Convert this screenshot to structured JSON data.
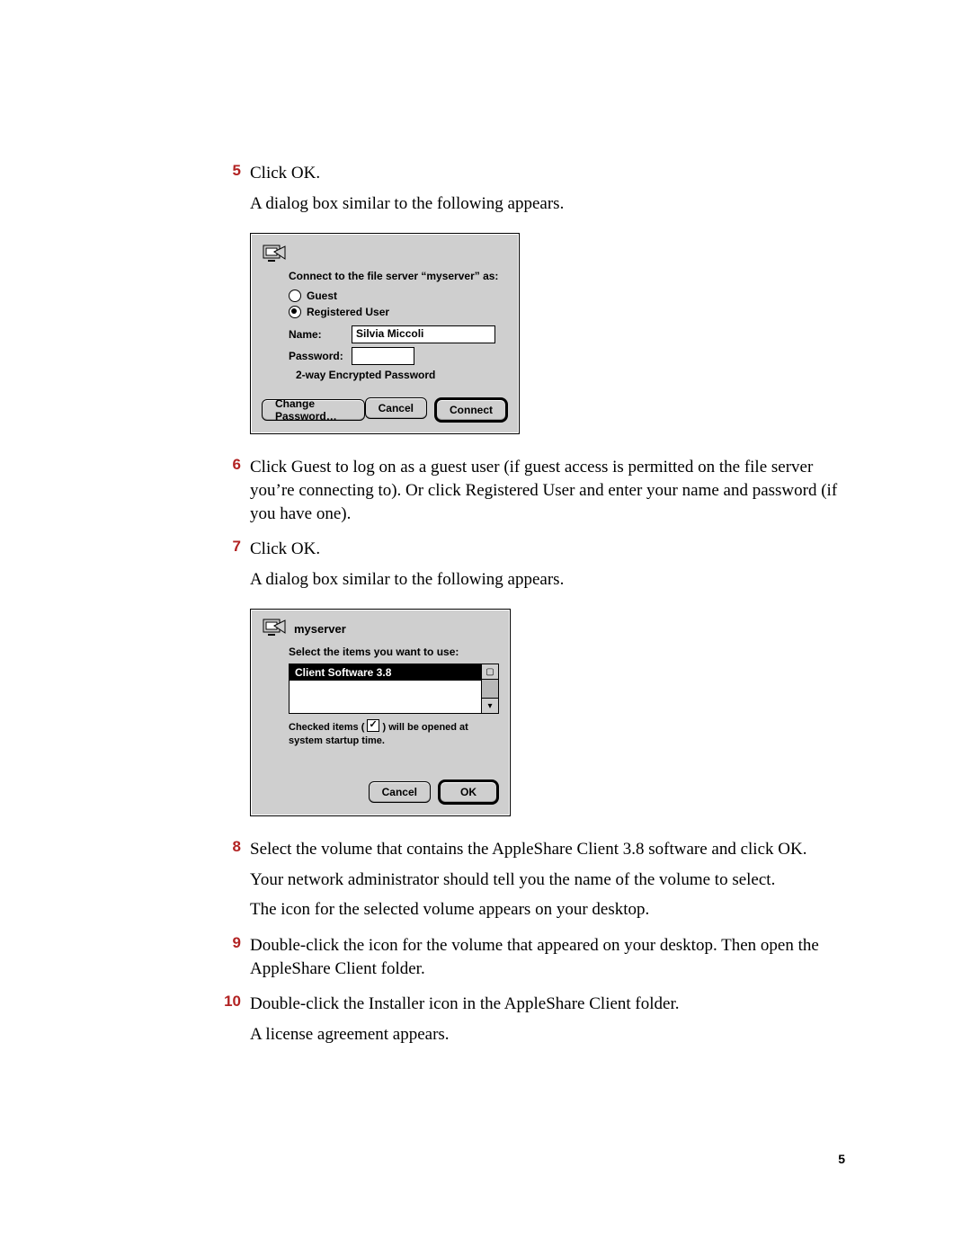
{
  "page_number": "5",
  "steps": {
    "5": {
      "num": "5",
      "text": "Click OK.",
      "after": "A dialog box similar to the following appears."
    },
    "6": {
      "num": "6",
      "text": "Click Guest to log on as a guest user (if guest access is permitted on the file server you’re connecting to). Or click Registered User and enter your name and password (if you have one)."
    },
    "7": {
      "num": "7",
      "text": "Click OK.",
      "after": "A dialog box similar to the following appears."
    },
    "8": {
      "num": "8",
      "text": "Select the volume that contains the AppleShare Client 3.8 software and click OK.",
      "after1": "Your network administrator should tell you the name of the volume to select.",
      "after2": "The icon for the selected volume appears on your desktop."
    },
    "9": {
      "num": "9",
      "text": "Double-click the icon for the volume that appeared on your desktop. Then open the AppleShare Client folder."
    },
    "10": {
      "num": "10",
      "text": "Double-click the Installer icon in the AppleShare Client folder.",
      "after": "A license agreement appears."
    }
  },
  "dialog_connect": {
    "caption": "Connect to the file server “myserver” as:",
    "guest_label": "Guest",
    "guest_selected": false,
    "registered_label": "Registered User",
    "registered_selected": true,
    "name_label": "Name:",
    "name_value": "Silvia Miccoli",
    "password_label": "Password:",
    "password_value": "",
    "encryption_note": "2-way Encrypted Password",
    "change_password": "Change Password…",
    "cancel": "Cancel",
    "connect": "Connect"
  },
  "dialog_volumes": {
    "server_name": "myserver",
    "prompt": "Select the items you want to use:",
    "items": [
      {
        "label": "Client Software 3.8",
        "selected": true
      }
    ],
    "hint_pre": "Checked items (",
    "hint_post": ") will be opened at system startup time.",
    "cancel": "Cancel",
    "ok": "OK"
  }
}
